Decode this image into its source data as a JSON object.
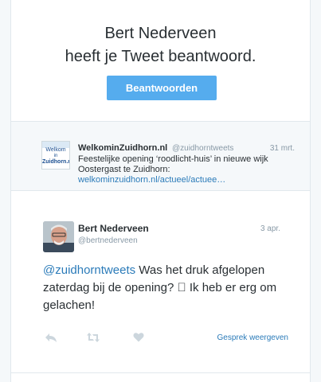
{
  "header": {
    "line1": "Bert Nederveen",
    "line2": "heeft je Tweet beantwoord.",
    "reply_button": "Beantwoorden"
  },
  "quoted_tweet": {
    "avatar_text": [
      "Welkom",
      "in",
      "Zuidhorn.nl"
    ],
    "name": "WelkominZuidhorn.nl",
    "handle": "@zuidhorntweets",
    "time": "31 mrt.",
    "text": "Feestelijke opening ‘roodlicht-huis’ in nieuwe wijk Oostergast te Zuidhorn:",
    "link": "welkominzuidhorn.nl/actueel/actuee…"
  },
  "reply_tweet": {
    "name": "Bert Nederveen",
    "handle": "@bertnederveen",
    "time": "3 apr.",
    "mention": "@zuidhorntweets",
    "text": " Was het druk afgelopen zaterdag bij de opening? ⃞ Ik heb er erg om gelachen!"
  },
  "actions": {
    "reply_icon": "reply-icon",
    "retweet_icon": "retweet-icon",
    "favorite_icon": "heart-icon",
    "conversation_link": "Gesprek weergeven"
  },
  "colors": {
    "accent": "#55acee",
    "link": "#2b7bb9",
    "muted": "#8899a6",
    "text": "#292f33"
  }
}
